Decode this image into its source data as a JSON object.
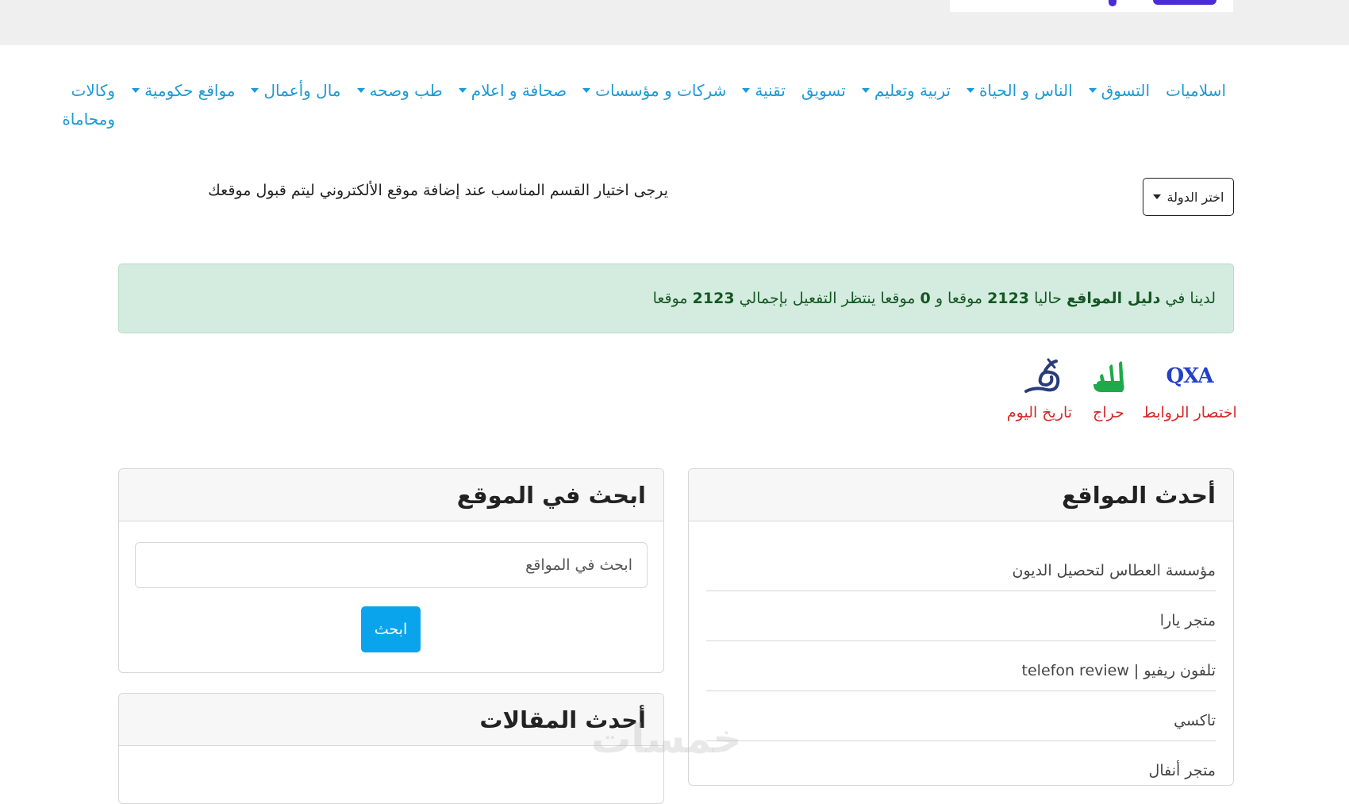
{
  "nav": {
    "items": [
      {
        "label": "اسلاميات",
        "dropdown": false
      },
      {
        "label": "التسوق",
        "dropdown": true
      },
      {
        "label": "الناس و الحياة",
        "dropdown": true
      },
      {
        "label": "تربية وتعليم",
        "dropdown": true
      },
      {
        "label": "تسويق",
        "dropdown": false
      },
      {
        "label": "تقنية",
        "dropdown": true
      },
      {
        "label": "شركات و مؤسسات",
        "dropdown": true
      },
      {
        "label": "صحافة و اعلام",
        "dropdown": true
      },
      {
        "label": "طب وصحه",
        "dropdown": true
      },
      {
        "label": "مال وأعمال",
        "dropdown": true
      },
      {
        "label": "مواقع حكومية",
        "dropdown": true
      }
    ],
    "last": "وكالات ومحاماة"
  },
  "country_select": {
    "label": "اختر الدولة"
  },
  "notice": "يرجى اختيار القسم المناسب عند إضافة موقع الألكتروني ليتم قبول موقعك",
  "alert": {
    "prefix": "لدينا في",
    "site_name": "دليل المواقع",
    "t1": "حاليا",
    "active_count": "2123",
    "t2": "موقعا و",
    "pending_count": "0",
    "t3": "موقعا ينتظر التفعيل بإجمالي",
    "total_count": "2123",
    "t4": "موقعا"
  },
  "partners": [
    {
      "label": "اختصار الروابط",
      "logo_text": "QXA",
      "icon": "qxa-logo"
    },
    {
      "label": "حراج",
      "icon": "haraj-logo"
    },
    {
      "label": "تاريخ اليوم",
      "icon": "calendar-hijri-logo"
    }
  ],
  "latest_sites": {
    "title": "أحدث المواقع",
    "items": [
      "مؤسسة العطاس لتحصيل الديون",
      "متجر يارا",
      "تلفون ريفيو | telefon review",
      "تاكسي",
      "متجر أنفال"
    ]
  },
  "search": {
    "title": "ابحث في الموقع",
    "placeholder": "ابحث في المواقع",
    "button": "ابحث"
  },
  "articles": {
    "title": "أحدث المقالات"
  },
  "watermark": "خمسات",
  "colors": {
    "link": "#1b9ad6",
    "alert_bg": "#d4ecdf",
    "button": "#09a4eb",
    "partner_label": "#d62828"
  }
}
